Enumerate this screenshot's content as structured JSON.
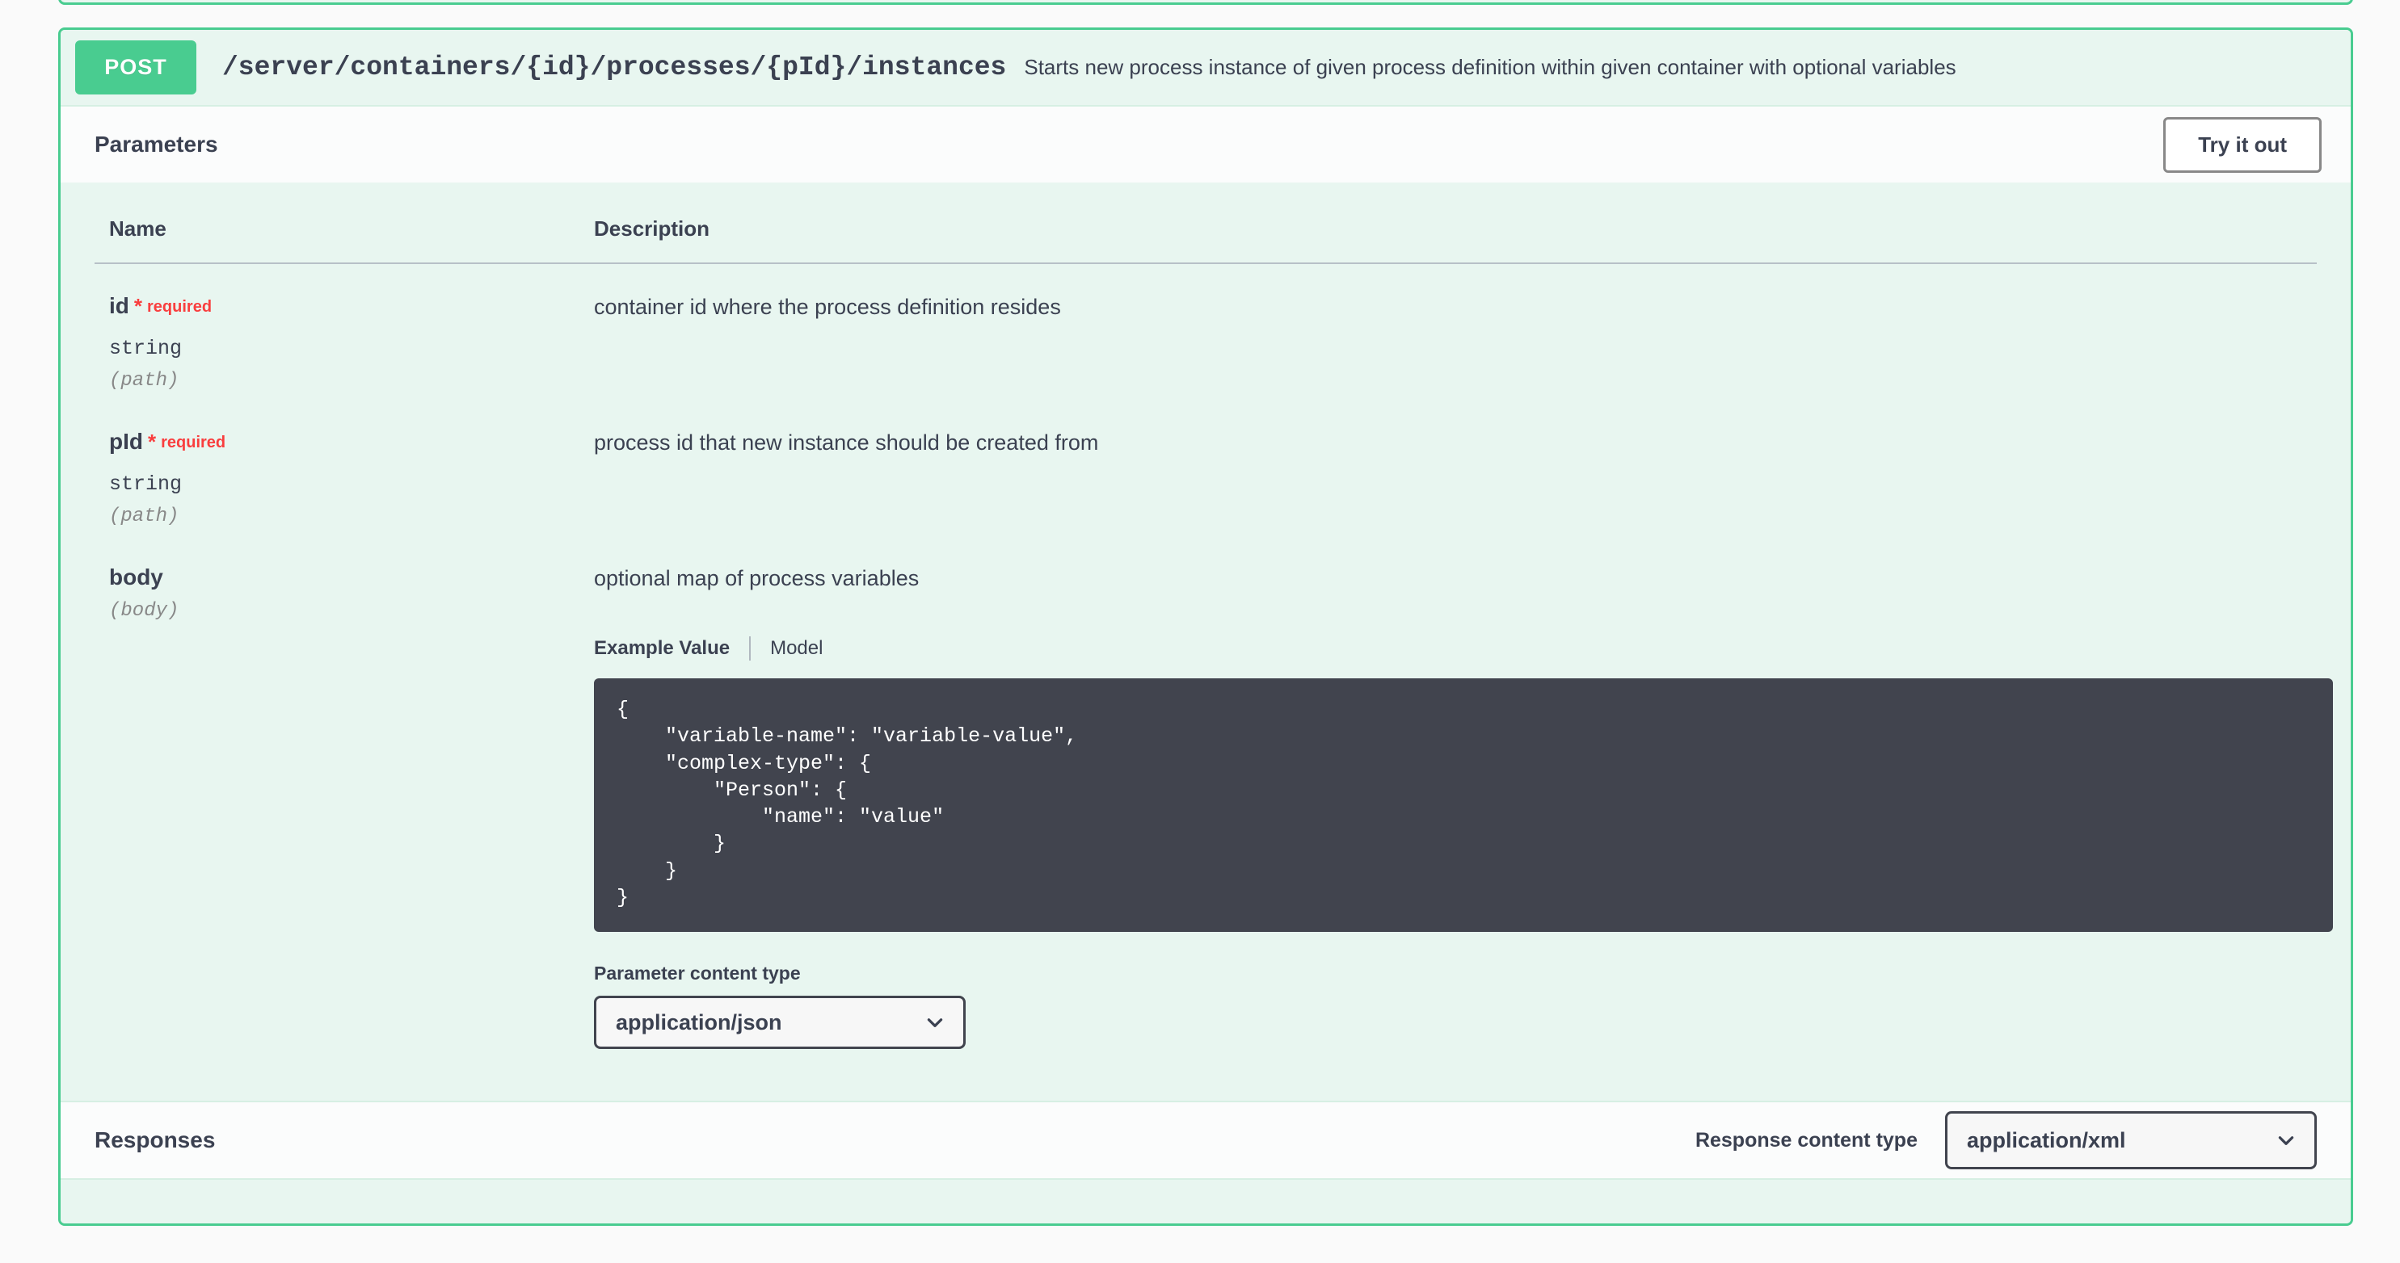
{
  "operation": {
    "method": "POST",
    "path": "/server/containers/{id}/processes/{pId}/instances",
    "description": "Starts new process instance of given process definition within given container with optional variables",
    "method_color": "#49cc90",
    "block_bg": "#e8f6f0"
  },
  "parameters_section": {
    "title": "Parameters",
    "try_it_out_label": "Try it out",
    "columns": {
      "name": "Name",
      "description": "Description"
    },
    "rows": [
      {
        "name": "id",
        "star": "*",
        "required_label": "required",
        "type": "string",
        "in": "(path)",
        "description": "container id where the process definition resides"
      },
      {
        "name": "pId",
        "star": "*",
        "required_label": "required",
        "type": "string",
        "in": "(path)",
        "description": "process id that new instance should be created from"
      },
      {
        "name": "body",
        "star": "",
        "required_label": "",
        "type": "",
        "in": "(body)",
        "description": "optional map of process variables"
      }
    ],
    "body_tabs": {
      "example_value": "Example Value",
      "model": "Model",
      "active": "Example Value"
    },
    "example_code": "{\n    \"variable-name\": \"variable-value\",\n    \"complex-type\": {\n        \"Person\": {\n            \"name\": \"value\"\n        }\n    }\n}",
    "parameter_content_type": {
      "label": "Parameter content type",
      "value": "application/json",
      "chevron": "chevron-down-icon"
    }
  },
  "responses_section": {
    "title": "Responses",
    "response_content_type": {
      "label": "Response content type",
      "value": "application/xml",
      "chevron": "chevron-down-icon"
    }
  }
}
